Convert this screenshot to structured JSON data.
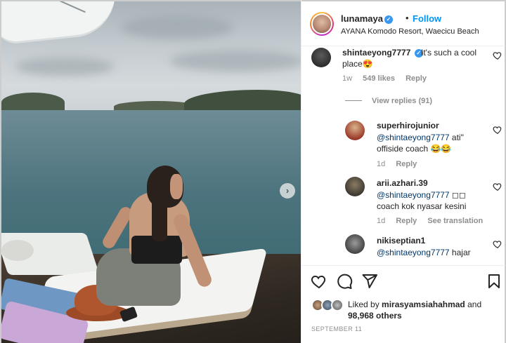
{
  "post": {
    "username": "lunamaya",
    "follow_label": "Follow",
    "dot": "•",
    "location": "AYANA Komodo Resort, Waecicu Beach",
    "more_label": "···"
  },
  "comments": [
    {
      "username": "shintaeyong7777",
      "verified": true,
      "text": "It's such a cool place😍",
      "age": "1w",
      "likes": "549 likes",
      "reply_label": "Reply"
    }
  ],
  "view_replies_label": "View replies (91)",
  "replies": [
    {
      "username": "superhirojunior",
      "mention": "@shintaeyong7777",
      "text": " ati\" offiside coach 😂😂",
      "age": "1d",
      "reply_label": "Reply"
    },
    {
      "username": "arii.azhari.39",
      "mention": "@shintaeyong7777",
      "text": " ◻◻ coach kok nyasar kesini",
      "age": "1d",
      "reply_label": "Reply",
      "translate_label": "See translation"
    },
    {
      "username": "nikiseptian1",
      "mention": "@shintaeyong7777",
      "text": " hajar"
    }
  ],
  "likes": {
    "prefix": "Liked by ",
    "liked_by": "mirasyamsiahahmad",
    "suffix": " and",
    "count": "98,968 others"
  },
  "date": "SEPTEMBER 11",
  "icons": {
    "like": "heart-icon",
    "comment": "comment-icon",
    "share": "send-icon",
    "save": "bookmark-icon",
    "carousel": "chevron-right-icon",
    "verified": "verified-badge-icon"
  },
  "colors": {
    "follow": "#0095f6",
    "verified": "#3897f0",
    "mention": "#00376b",
    "meta": "#8e8e8e"
  }
}
